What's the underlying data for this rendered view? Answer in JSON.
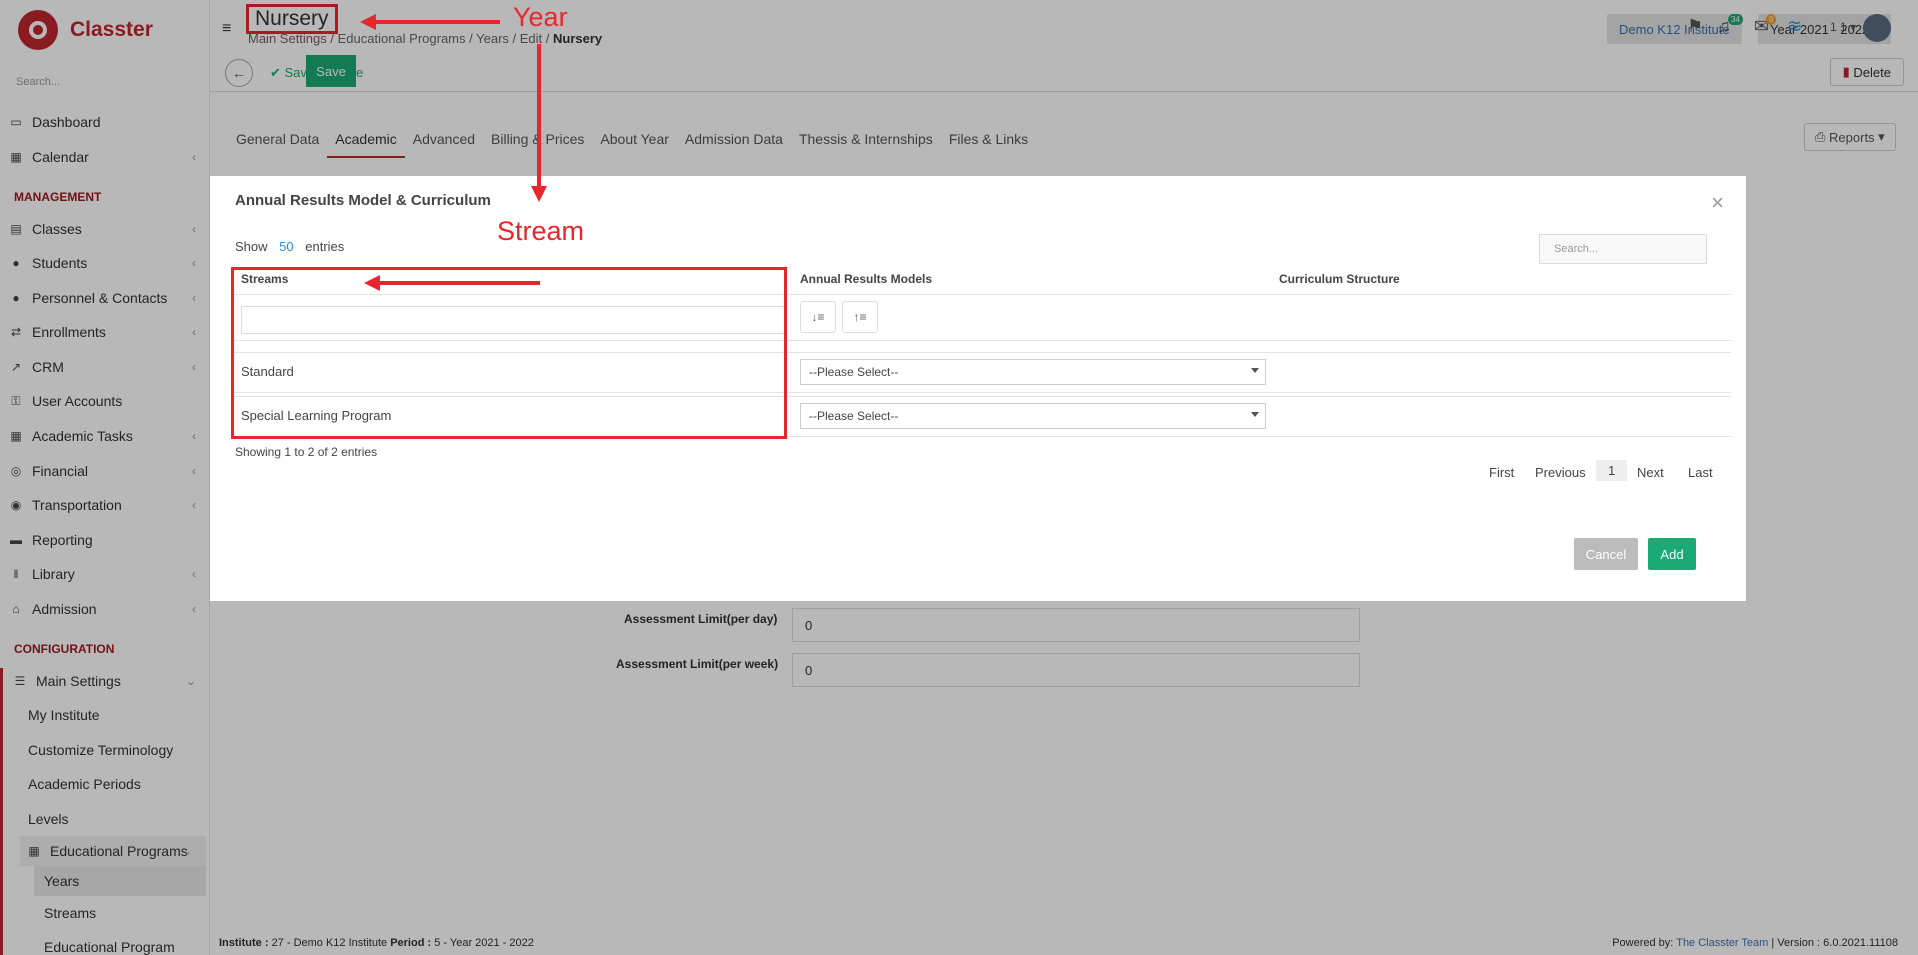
{
  "app": {
    "name": "Classter"
  },
  "sidebar": {
    "search_placeholder": "Search...",
    "items": [
      {
        "label": "Dashboard"
      },
      {
        "label": "Calendar"
      },
      {
        "label": "Classes"
      },
      {
        "label": "Students"
      },
      {
        "label": "Personnel & Contacts"
      },
      {
        "label": "Enrollments"
      },
      {
        "label": "CRM"
      },
      {
        "label": "User Accounts"
      },
      {
        "label": "Academic Tasks"
      },
      {
        "label": "Financial"
      },
      {
        "label": "Transportation"
      },
      {
        "label": "Reporting"
      },
      {
        "label": "Library"
      },
      {
        "label": "Admission"
      }
    ],
    "management_label": "MANAGEMENT",
    "configuration_label": "CONFIGURATION",
    "main_settings": "Main Settings",
    "sub_items": [
      "My Institute",
      "Customize Terminology",
      "Academic Periods",
      "Levels"
    ],
    "educational_programs": "Educational Programs",
    "edu_sub_items": [
      "Years",
      "Streams",
      "Educational Program"
    ]
  },
  "header": {
    "title": "Nursery",
    "breadcrumb": [
      "Main Settings",
      "Educational Programs",
      "Years",
      "Edit"
    ],
    "breadcrumb_current": "Nursery",
    "institute": "Demo K12 Institute",
    "year": "Year 2021 - 2022",
    "notif_count": "34",
    "mail_count": "0",
    "user_short": "1 1"
  },
  "toolbar": {
    "save_close": "Save & Close",
    "save": "Save",
    "delete": "Delete"
  },
  "tabs": [
    "General Data",
    "Academic",
    "Advanced",
    "Billing & Prices",
    "About Year",
    "Admission Data",
    "Thessis & Internships",
    "Files & Links"
  ],
  "reports": "Reports",
  "background_fields": [
    {
      "label": "Assessment Limit(per day)",
      "value": "0"
    },
    {
      "label": "Assessment Limit(per week)",
      "value": "0"
    }
  ],
  "modal": {
    "title": "Annual Results Model & Curriculum",
    "show": "Show",
    "entries_count": "50",
    "entries": "entries",
    "search_placeholder": "Search...",
    "columns": [
      "Streams",
      "Annual Results Models",
      "Curriculum Structure"
    ],
    "rows": [
      {
        "stream": "Standard",
        "model": "--Please Select--"
      },
      {
        "stream": "Special Learning Program",
        "model": "--Please Select--"
      }
    ],
    "showing": "Showing 1 to 2 of 2 entries",
    "pager": {
      "first": "First",
      "previous": "Previous",
      "current": "1",
      "next": "Next",
      "last": "Last"
    },
    "cancel": "Cancel",
    "add": "Add"
  },
  "annotations": {
    "year": "Year",
    "stream": "Stream",
    "color": "#e8262e"
  },
  "footer": {
    "left_institute_label": "Institute :",
    "left_institute": "27 - Demo K12 Institute",
    "left_period_label": "Period :",
    "left_period": "5 - Year 2021 - 2022",
    "powered_by": "Powered by:",
    "team": "The Classter Team",
    "version": "| Version : 6.0.2021.11108"
  }
}
